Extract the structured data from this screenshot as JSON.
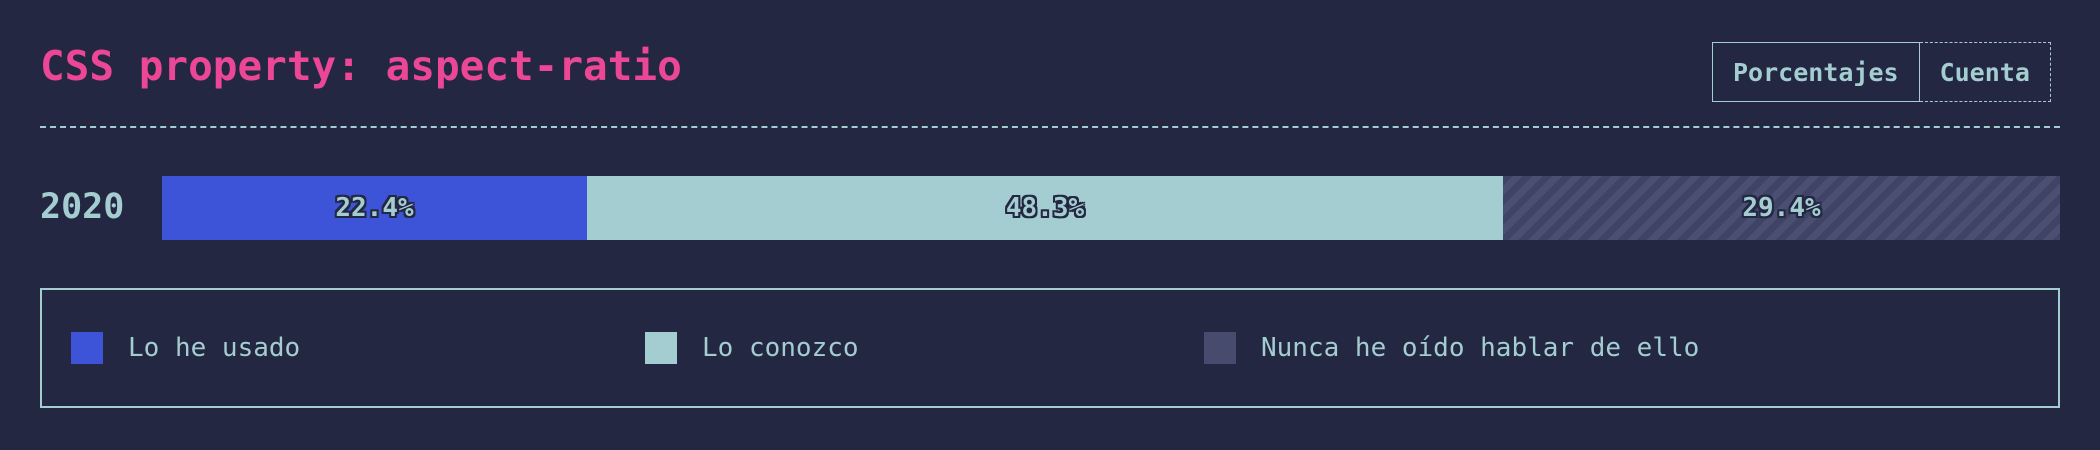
{
  "title": "CSS property: aspect-ratio",
  "toggle": {
    "options": [
      "Porcentajes",
      "Cuenta"
    ],
    "active": "Porcentajes"
  },
  "colors": {
    "background": "#232741",
    "accent": "#ec4796",
    "text": "#a3cdd0"
  },
  "chart_data": {
    "type": "bar",
    "orientation": "horizontal",
    "stacked": true,
    "categories": [
      "2020"
    ],
    "series": [
      {
        "name": "Lo he usado",
        "values": [
          22.4
        ],
        "label": "22.4%",
        "color": "#3d54d8",
        "pattern": "solid"
      },
      {
        "name": "Lo conozco",
        "values": [
          48.3
        ],
        "label": "48.3%",
        "color": "#a3cdd0",
        "pattern": "solid"
      },
      {
        "name": "Nunca he oído hablar de ello",
        "values": [
          29.4
        ],
        "label": "29.4%",
        "color": "#474b6e",
        "pattern": "striped"
      }
    ],
    "unit": "%",
    "xlim": [
      0,
      100
    ],
    "legend_position": "bottom"
  }
}
